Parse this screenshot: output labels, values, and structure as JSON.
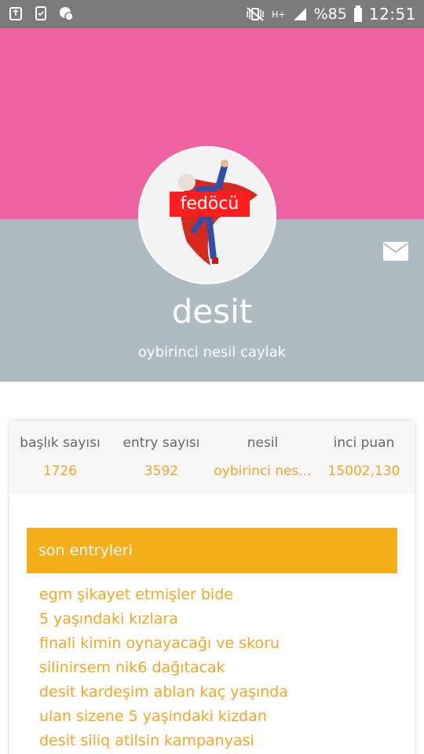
{
  "status_bar": {
    "left_icons": [
      "recycle-icon",
      "phone-check-icon",
      "chat-icon"
    ],
    "signal_label": "H+",
    "battery_percent": "%85",
    "time": "12:51"
  },
  "header": {
    "avatar_caption": "fedöcü",
    "username": "desit",
    "subtitle": "oybirinci nesil caylak",
    "mail_icon": "mail-icon"
  },
  "stats": [
    {
      "label": "başlık sayısı",
      "value": "1726"
    },
    {
      "label": "entry sayısı",
      "value": "3592"
    },
    {
      "label": "nesil",
      "value": "oybirinci nes..."
    },
    {
      "label": "inci puan",
      "value": "15002,130"
    }
  ],
  "recent": {
    "title": "son entryleri",
    "items": [
      "egm şikayet etmişler bide",
      "5 yaşındaki kızlara",
      "finali kimin oynayacağı ve skoru",
      "silinirsem nik6 dağıtacak",
      "desit kardeşim ablan kaç yaşında",
      "ulan sizene 5 yaşindaki kizdan",
      "desit siliq atilsin kampanyasi"
    ]
  },
  "colors": {
    "header_pink": "#ef62a1",
    "header_slate": "#aebbc3",
    "accent_orange": "#f3ae1a",
    "link_orange": "#f5a623"
  }
}
